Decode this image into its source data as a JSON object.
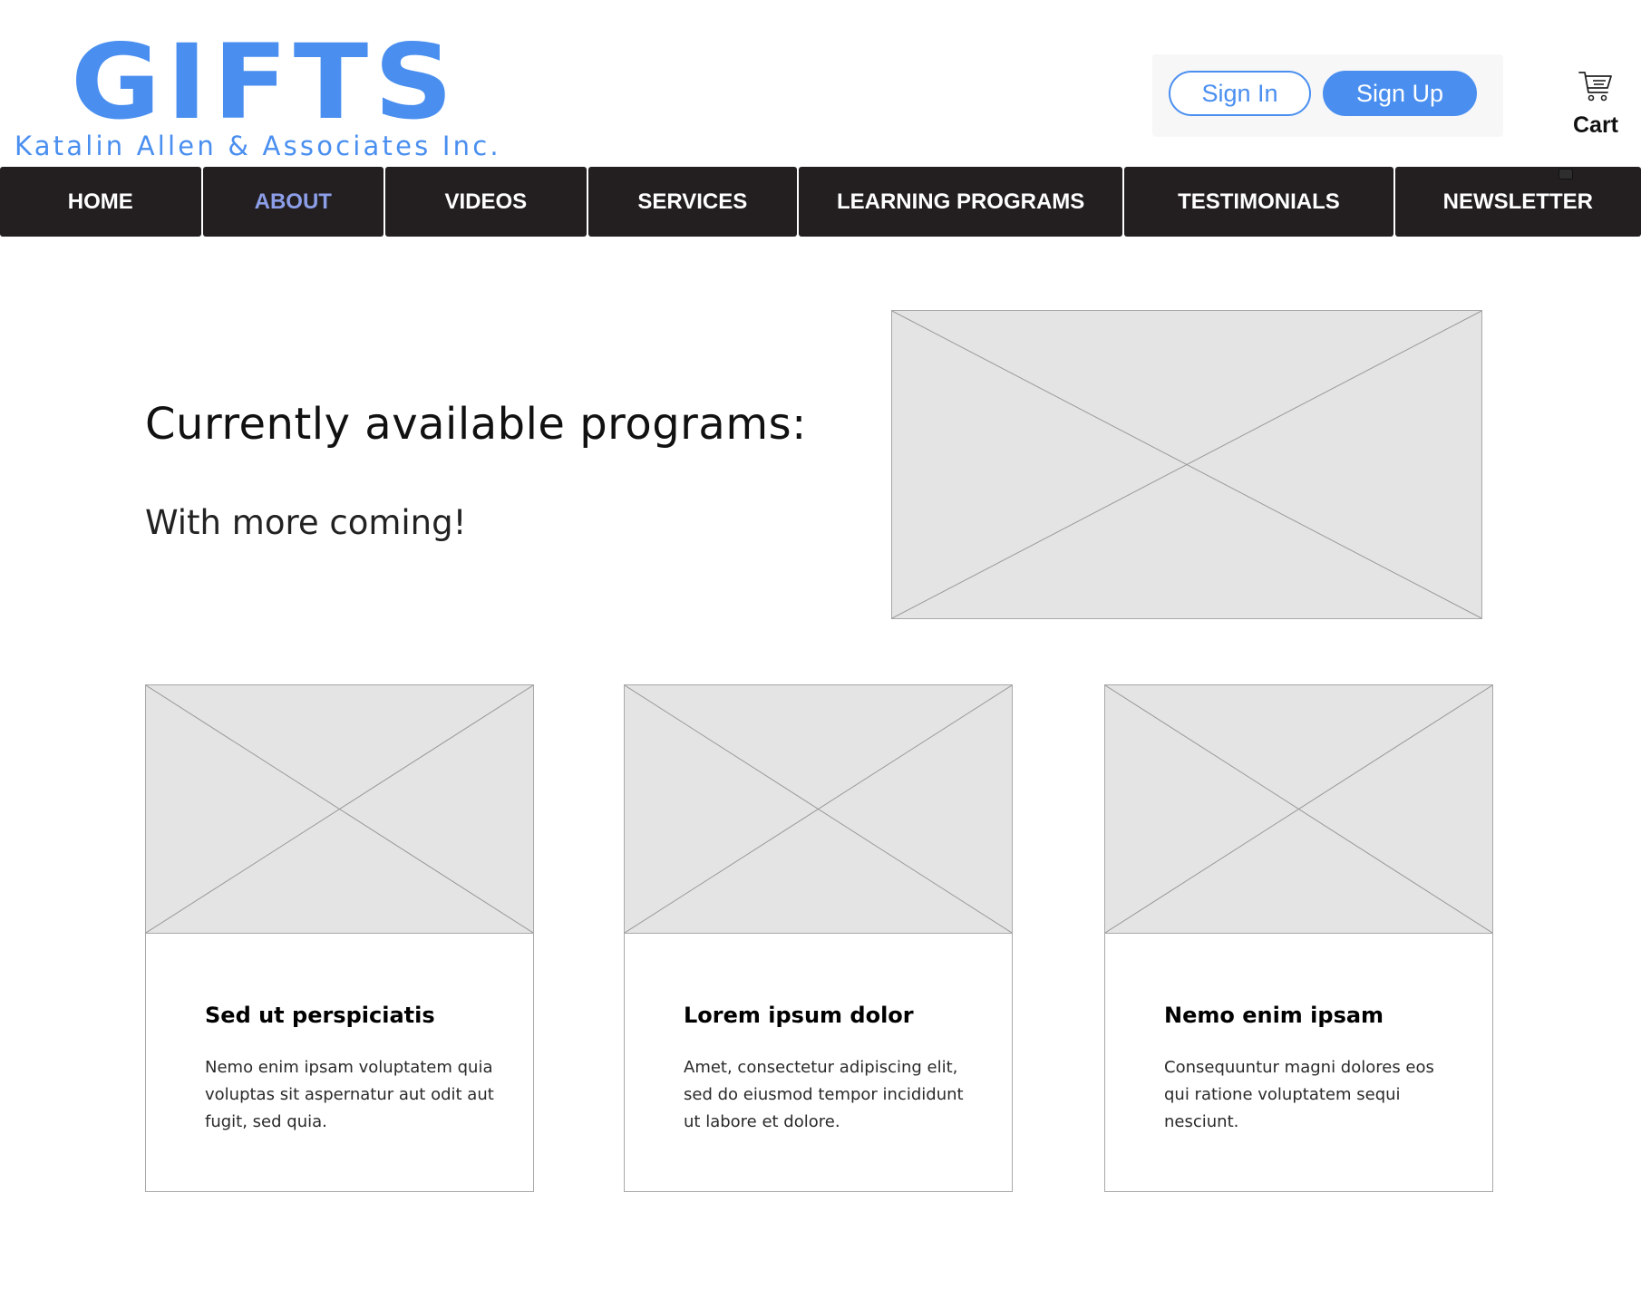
{
  "brand": {
    "logo_text": "GIFTS",
    "tagline": "Katalin Allen & Associates Inc.",
    "color": "#4a8ff0"
  },
  "auth": {
    "sign_in_label": "Sign In",
    "sign_up_label": "Sign Up"
  },
  "cart": {
    "label": "Cart",
    "icon": "shopping-cart-icon"
  },
  "nav": {
    "items": [
      {
        "label": "HOME",
        "active": false
      },
      {
        "label": "ABOUT",
        "active": true
      },
      {
        "label": "VIDEOS",
        "active": false
      },
      {
        "label": "SERVICES",
        "active": false
      },
      {
        "label": "LEARNING PROGRAMS",
        "active": false
      },
      {
        "label": "TESTIMONIALS",
        "active": false
      },
      {
        "label": "NEWSLETTER",
        "active": false
      }
    ],
    "background": "#231f20",
    "active_color": "#8c9ee8"
  },
  "hero": {
    "title": "Currently available programs:",
    "subtitle": "With more coming!",
    "image_icon": "image-placeholder-icon"
  },
  "cards": [
    {
      "title": "Sed ut perspiciatis",
      "text": "Nemo enim ipsam voluptatem quia voluptas sit aspernatur aut odit aut fugit, sed quia."
    },
    {
      "title": "Lorem ipsum dolor",
      "text": "Amet, consectetur adipiscing elit, sed do eiusmod tempor incididunt ut labore et dolore."
    },
    {
      "title": "Nemo enim ipsam",
      "text": "Consequuntur magni dolores eos qui ratione voluptatem sequi nesciunt."
    }
  ]
}
